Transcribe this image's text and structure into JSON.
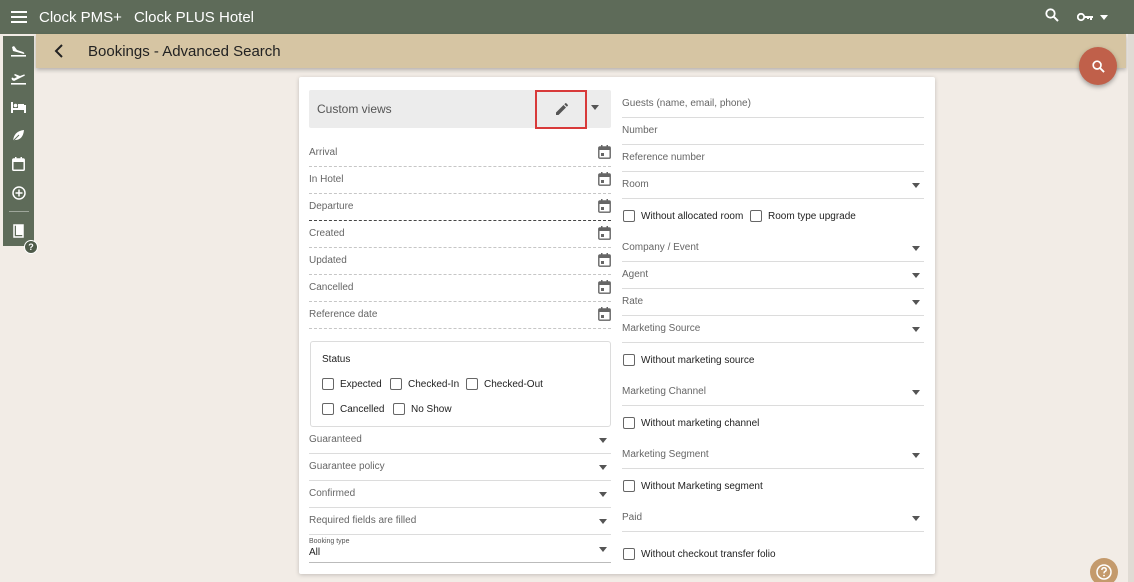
{
  "header": {
    "app_name": "Clock PMS+",
    "hotel_name": "Clock PLUS Hotel"
  },
  "subheader": {
    "title": "Bookings - Advanced Search"
  },
  "sidebar": {
    "items": [
      {
        "icon": "flight-land-icon"
      },
      {
        "icon": "flight-takeoff-icon"
      },
      {
        "icon": "hotel-bed-icon"
      },
      {
        "icon": "leaf-icon"
      },
      {
        "icon": "calendar-icon"
      },
      {
        "icon": "add-circle-icon"
      },
      {
        "icon": "book-icon"
      }
    ],
    "help_label": "?"
  },
  "search_form": {
    "custom_views_label": "Custom views",
    "left_fields": {
      "arrival": "Arrival",
      "in_hotel": "In Hotel",
      "departure": "Departure",
      "created": "Created",
      "updated": "Updated",
      "cancelled": "Cancelled",
      "reference_date": "Reference date"
    },
    "status": {
      "title": "Status",
      "options": {
        "expected": "Expected",
        "checked_in": "Checked-In",
        "checked_out": "Checked-Out",
        "cancelled": "Cancelled",
        "no_show": "No Show"
      }
    },
    "left_selects": {
      "guaranteed": "Guaranteed",
      "guarantee_policy": "Guarantee policy",
      "confirmed": "Confirmed",
      "required_fields": "Required fields are filled"
    },
    "booking_type": {
      "label": "Booking type",
      "value": "All"
    },
    "right_fields": {
      "guests": "Guests (name, email, phone)",
      "number": "Number",
      "reference_number": "Reference number",
      "room": "Room",
      "without_allocated_room": "Without allocated room",
      "room_type_upgrade": "Room type upgrade",
      "company_event": "Company / Event",
      "agent": "Agent",
      "rate": "Rate",
      "marketing_source": "Marketing Source",
      "without_marketing_source": "Without marketing source",
      "marketing_channel": "Marketing Channel",
      "without_marketing_channel": "Without marketing channel",
      "marketing_segment": "Marketing Segment",
      "without_marketing_segment": "Without Marketing segment",
      "paid": "Paid",
      "without_checkout_transfer_folio": "Without checkout transfer folio"
    }
  },
  "colors": {
    "topbar": "#5e6b59",
    "subbar": "#d6c5a3",
    "fab": "#c0604a",
    "highlight": "#d83a3a",
    "background": "#f2ece6"
  }
}
